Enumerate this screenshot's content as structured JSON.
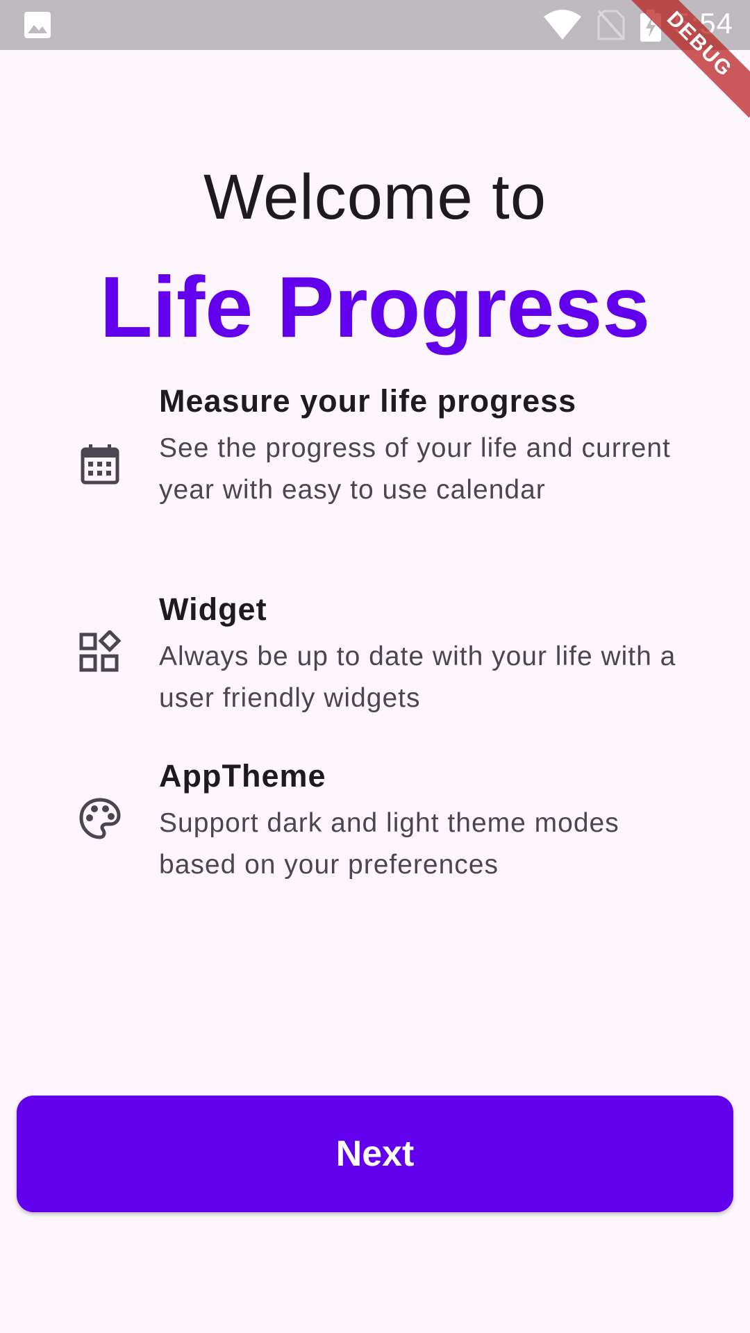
{
  "status_bar": {
    "time": "5:54",
    "icons": [
      "gallery-icon",
      "wifi-icon",
      "no-sim-icon",
      "battery-charging-icon"
    ]
  },
  "debug_banner": "DEBUG",
  "heading": {
    "welcome": "Welcome to",
    "app_name": "Life Progress"
  },
  "features": [
    {
      "icon": "calendar-icon",
      "title": "Measure your life progress",
      "description": "See the progress of your life and current year with easy to use calendar"
    },
    {
      "icon": "widgets-icon",
      "title": "Widget",
      "description": "Always be up to date with your life with a user friendly widgets"
    },
    {
      "icon": "palette-icon",
      "title": "AppTheme",
      "description": "Support dark and light theme modes based on your preferences"
    }
  ],
  "next_button": {
    "label": "Next"
  },
  "colors": {
    "primary": "#6200ee",
    "background": "#fdf7fd",
    "status_bar": "#bdb9be",
    "text": "#1e1b20",
    "secondary_text": "#4a4550"
  }
}
